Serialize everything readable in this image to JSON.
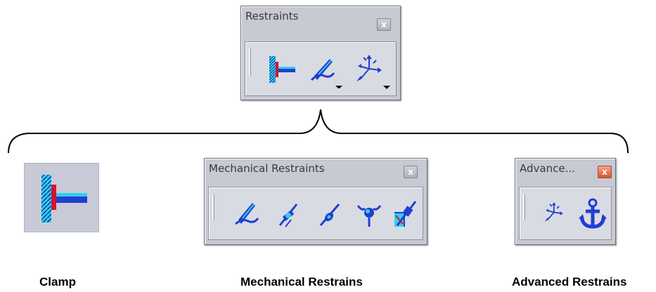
{
  "restraints_toolbar": {
    "title": "Restraints",
    "close_symbol": "x",
    "icons": [
      "clamp-icon",
      "mechanical-restraint-icon",
      "advanced-restraint-icon"
    ]
  },
  "mechanical_toolbar": {
    "title": "Mechanical Restraints",
    "close_symbol": "x",
    "icons": [
      "surface-slider-icon",
      "slider-icon",
      "sliding-pivot-icon",
      "ball-join-icon",
      "pivot-icon"
    ]
  },
  "advanced_toolbar": {
    "title": "Advance...",
    "close_symbol": "x",
    "icons": [
      "advanced-restraint-icon",
      "isostatic-restraint-icon"
    ]
  },
  "clamp_icon_name": "clamp-icon",
  "captions": {
    "clamp": "Clamp",
    "mechanical": "Mechanical Restrains",
    "advanced": "Advanced Restrains"
  },
  "colors": {
    "toolbar_bg": "#c7c9d3",
    "icon_blue": "#1f3fd0",
    "icon_cyan": "#2fd0f0",
    "icon_red": "#d4142c"
  }
}
